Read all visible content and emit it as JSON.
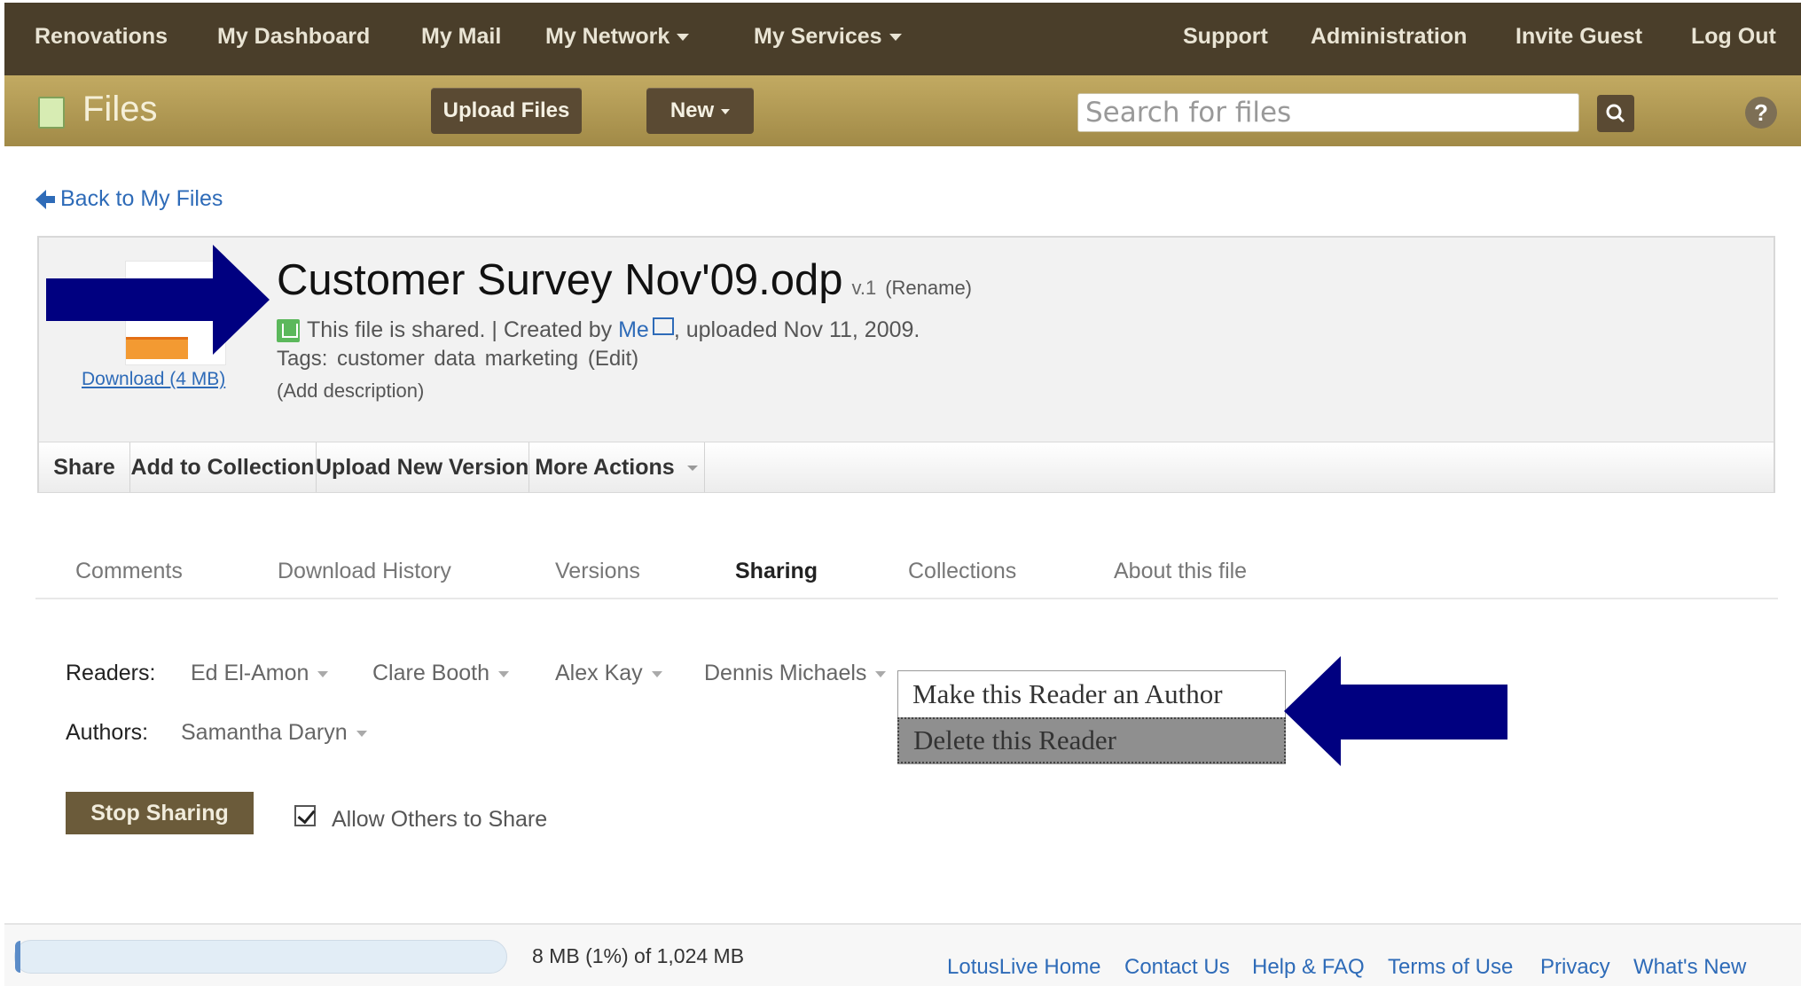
{
  "nav": {
    "renovations": "Renovations",
    "dashboard": "My Dashboard",
    "mail": "My Mail",
    "network": "My Network",
    "services": "My Services",
    "support": "Support",
    "administration": "Administration",
    "invite_guest": "Invite Guest",
    "logout": "Log Out"
  },
  "filesbar": {
    "title": "Files",
    "upload_label": "Upload Files",
    "new_label": "New",
    "search_placeholder": "Search for files",
    "help_label": "?"
  },
  "back_link": "Back to My Files",
  "file": {
    "name": "Customer Survey Nov'09.odp",
    "version": "v.1",
    "rename": "(Rename)",
    "shared_text": "This file is shared. | Created by ",
    "creator": "Me",
    "uploaded_text": ", uploaded Nov 11, 2009.",
    "tags_text": "Tags: customer data marketing",
    "tags_edit": "(Edit)",
    "add_description": "(Add description)",
    "download": "Download (4 MB)"
  },
  "actions": {
    "share": "Share",
    "add_to_collection": "Add to Collection",
    "upload_new_version": "Upload New Version",
    "more_actions": "More Actions"
  },
  "tabs": {
    "comments": "Comments",
    "download_history": "Download History",
    "versions": "Versions",
    "sharing": "Sharing",
    "collections": "Collections",
    "about": "About this file"
  },
  "sharing": {
    "readers_label": "Readers:",
    "readers": [
      "Ed El-Amon",
      "Clare Booth",
      "Alex Kay",
      "Dennis Michaels"
    ],
    "authors_label": "Authors:",
    "authors": [
      "Samantha Daryn"
    ],
    "menu_make_author": "Make this Reader an Author",
    "menu_delete_reader": "Delete this Reader",
    "stop_sharing": "Stop Sharing",
    "allow_others": "Allow Others to Share",
    "allow_others_checked": true
  },
  "footer": {
    "quota_text": "8 MB (1%) of 1,024 MB",
    "quota_fraction": 0.01,
    "links": [
      "LotusLive Home",
      "Contact Us",
      "Help & FAQ",
      "Terms of Use",
      "Privacy",
      "What's New"
    ]
  },
  "colors": {
    "nav_bg": "#4a3e2a",
    "files_bar": "#b39b55",
    "link": "#2e6bb8",
    "arrow": "#000080"
  }
}
